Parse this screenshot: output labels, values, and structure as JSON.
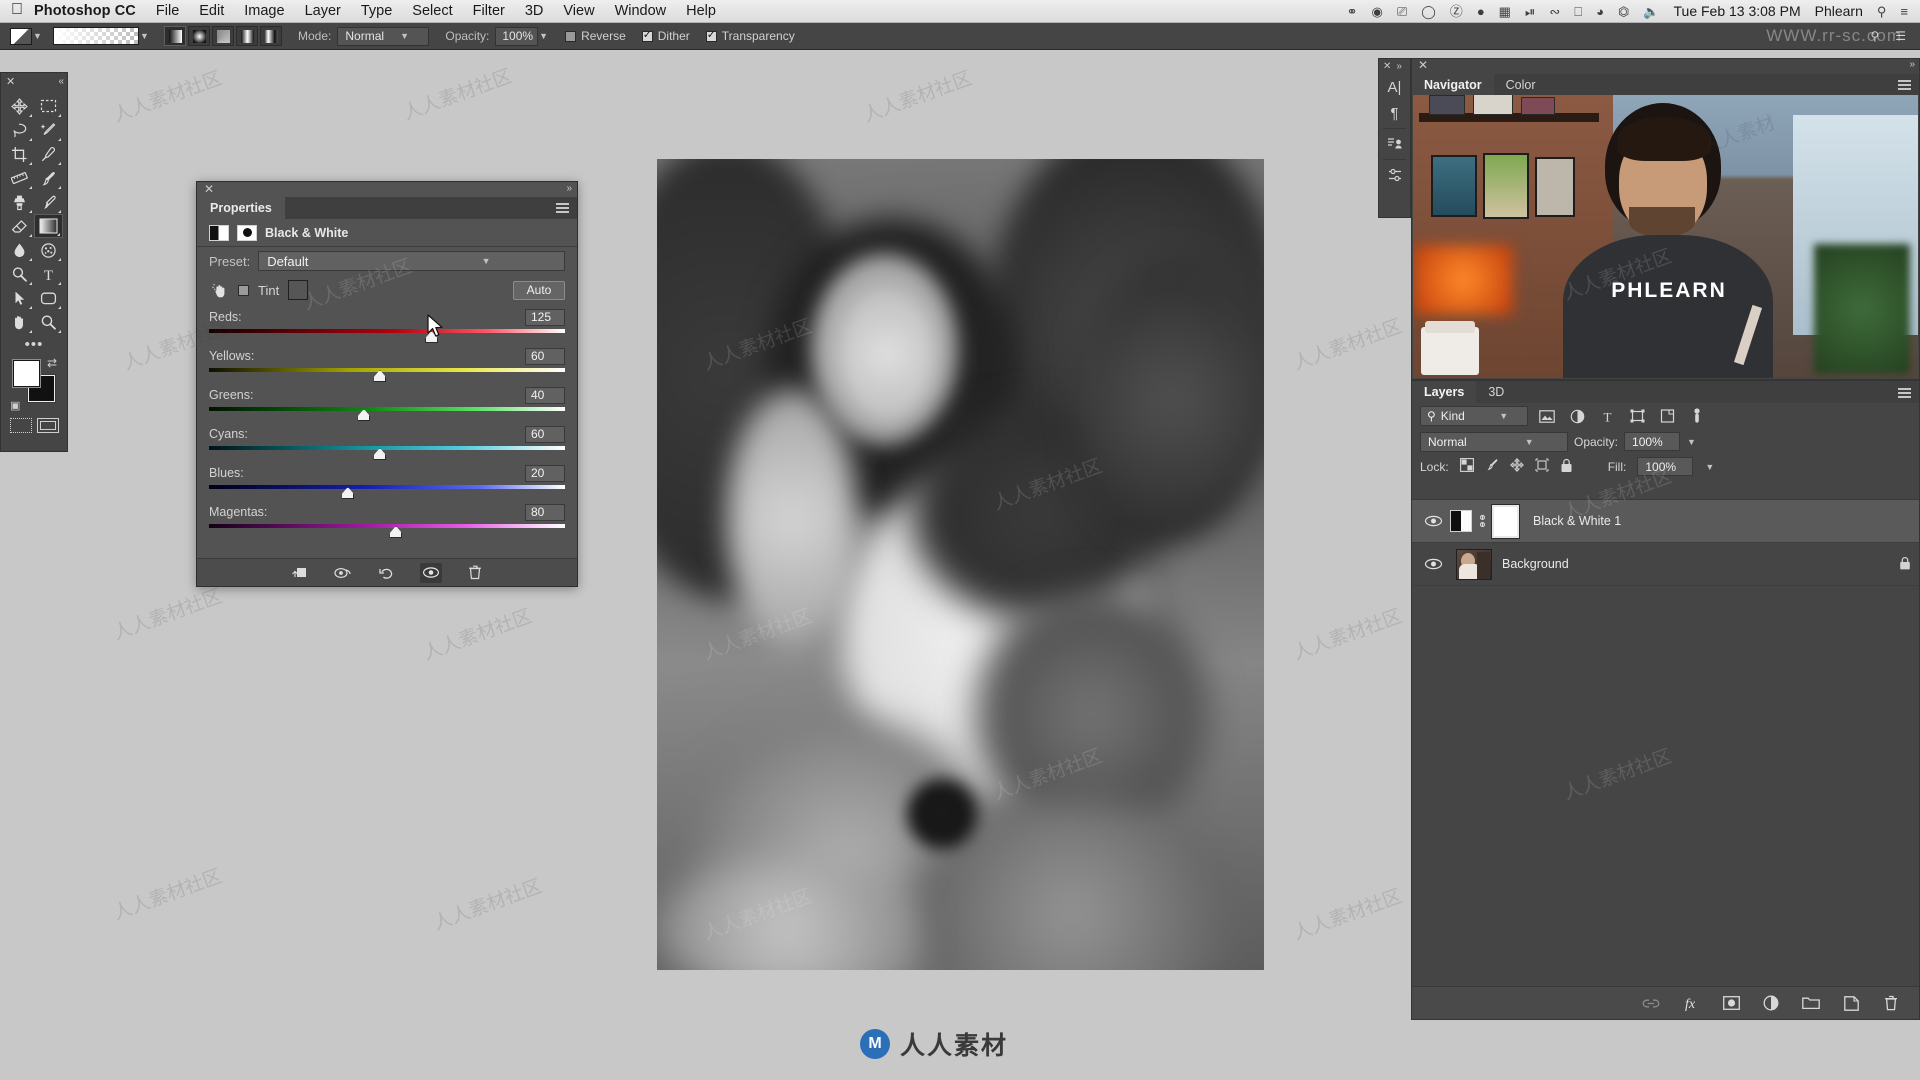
{
  "menubar": {
    "apple_icon": "apple-logo",
    "app_name": "Photoshop CC",
    "items": [
      "File",
      "Edit",
      "Image",
      "Layer",
      "Type",
      "Select",
      "Filter",
      "3D",
      "View",
      "Window",
      "Help"
    ],
    "status_icons": [
      "dropbox-icon",
      "cc-icon",
      "screen-share-icon",
      "clock-icon",
      "dollar-icon",
      "battery-icon",
      "grid-icon",
      "timemachine-icon",
      "bluetooth-icon",
      "airplay-icon",
      "wifi-icon",
      "eject-icon",
      "volume-icon"
    ],
    "clock": "Tue Feb 13  3:08 PM",
    "user": "Phlearn",
    "search_icon": "search-icon",
    "notifications_icon": "notification-center-icon"
  },
  "options_bar": {
    "tool_preset_icon": "gradient-tool-preset",
    "gradient_preview": "foreground-to-transparent",
    "gradient_types": [
      "linear-gradient",
      "radial-gradient",
      "angle-gradient",
      "reflected-gradient",
      "diamond-gradient"
    ],
    "gradient_type_selected": 0,
    "mode_label": "Mode:",
    "mode_value": "Normal",
    "opacity_label": "Opacity:",
    "opacity_value": "100%",
    "reverse_label": "Reverse",
    "reverse_checked": false,
    "dither_label": "Dither",
    "dither_checked": true,
    "transparency_label": "Transparency",
    "transparency_checked": true
  },
  "toolbar": {
    "close_icon": "close-icon",
    "collapse_icon": "double-chevron-left-icon",
    "tools": [
      "move-tool",
      "rectangular-marquee-tool",
      "lasso-tool",
      "quick-selection-tool",
      "crop-tool",
      "eyedropper-tool",
      "ruler-tool",
      "brush-tool",
      "clone-stamp-tool",
      "history-brush-tool",
      "eraser-tool",
      "gradient-tool",
      "blur-tool",
      "sponge-tool",
      "dodge-tool",
      "type-tool",
      "path-selection-tool",
      "rounded-rectangle-tool",
      "hand-tool",
      "zoom-tool"
    ],
    "selected_tool": "gradient-tool",
    "more_tools_icon": "ellipsis-icon",
    "foreground_color": "#ffffff",
    "background_color": "#111111",
    "swap_colors_icon": "swap-colors-icon",
    "default_colors_icon": "default-colors-icon",
    "quickmask_icon": "quick-mask-icon",
    "screenmode_icon": "screen-mode-icon"
  },
  "properties_panel": {
    "close_icon": "close-icon",
    "collapse_icon": "double-chevron-right-icon",
    "tab_label": "Properties",
    "menu_icon": "panel-menu-icon",
    "adjustment_icon": "black-and-white-adjustment-icon",
    "mask_icon": "layer-mask-icon",
    "adjustment_title": "Black & White",
    "preset_label": "Preset:",
    "preset_value": "Default",
    "targeted_adjust_icon": "on-image-adjustment-tool-icon",
    "tint_label": "Tint",
    "tint_checked": false,
    "tint_color": "#565656",
    "auto_label": "Auto",
    "sliders": [
      {
        "name": "Reds:",
        "value": "125",
        "pct": 0.625,
        "track": "t-red"
      },
      {
        "name": "Yellows:",
        "value": "60",
        "pct": 0.48,
        "track": "t-yellow"
      },
      {
        "name": "Greens:",
        "value": "40",
        "pct": 0.435,
        "track": "t-green"
      },
      {
        "name": "Cyans:",
        "value": "60",
        "pct": 0.48,
        "track": "t-cyan"
      },
      {
        "name": "Blues:",
        "value": "20",
        "pct": 0.39,
        "track": "t-blue"
      },
      {
        "name": "Magentas:",
        "value": "80",
        "pct": 0.525,
        "track": "t-magenta"
      }
    ],
    "footer_icons": [
      "clip-to-layer-icon",
      "preview-toggle-icon",
      "reset-icon",
      "visibility-eye-icon",
      "delete-icon"
    ]
  },
  "mini_dock": {
    "close_icon": "close-icon",
    "expand_icon": "double-chevron-right-icon",
    "icons": [
      "character-panel-icon",
      "paragraph-panel-icon",
      "adjustments-panel-icon",
      "styles-panel-icon",
      "libraries-panel-icon"
    ]
  },
  "navigator_panel": {
    "close_icon": "close-icon",
    "collapse_icon": "double-chevron-right-icon",
    "tabs": [
      "Navigator",
      "Color"
    ],
    "active_tab": "Navigator",
    "menu_icon": "panel-menu-icon"
  },
  "layers_panel": {
    "tabs": [
      "Layers",
      "3D"
    ],
    "active_tab": "Layers",
    "menu_icon": "panel-menu-icon",
    "filter_icon": "search-icon",
    "filter_value": "Kind",
    "filter_type_icons": [
      "pixel-layers-filter-icon",
      "adjustment-layers-filter-icon",
      "type-layers-filter-icon",
      "shape-layers-filter-icon",
      "smart-object-filter-icon",
      "filter-toggle-icon"
    ],
    "blend_mode": "Normal",
    "opacity_label": "Opacity:",
    "opacity_value": "100%",
    "lock_label": "Lock:",
    "lock_icons": [
      "lock-transparent-pixels-icon",
      "lock-image-pixels-icon",
      "lock-position-icon",
      "lock-artboard-icon",
      "lock-all-icon"
    ],
    "fill_label": "Fill:",
    "fill_value": "100%",
    "layers": [
      {
        "name": "Black & White 1",
        "visible": true,
        "selected": true,
        "type": "adjustment",
        "eye_icon": "eye-icon",
        "link_icon": "link-mask-icon",
        "locked": false
      },
      {
        "name": "Background",
        "visible": true,
        "selected": false,
        "type": "image",
        "eye_icon": "eye-icon",
        "locked": true,
        "lock_icon": "lock-icon"
      }
    ],
    "footer_icons": [
      "link-layers-icon",
      "layer-style-icon",
      "layer-mask-icon",
      "new-adjustment-layer-icon",
      "new-group-icon",
      "new-layer-icon",
      "delete-layer-icon"
    ]
  },
  "watermark": {
    "text": "人人素材社区",
    "short": "人人素材",
    "url": "WWW.rr-sc.com",
    "logo_letter": "M"
  }
}
